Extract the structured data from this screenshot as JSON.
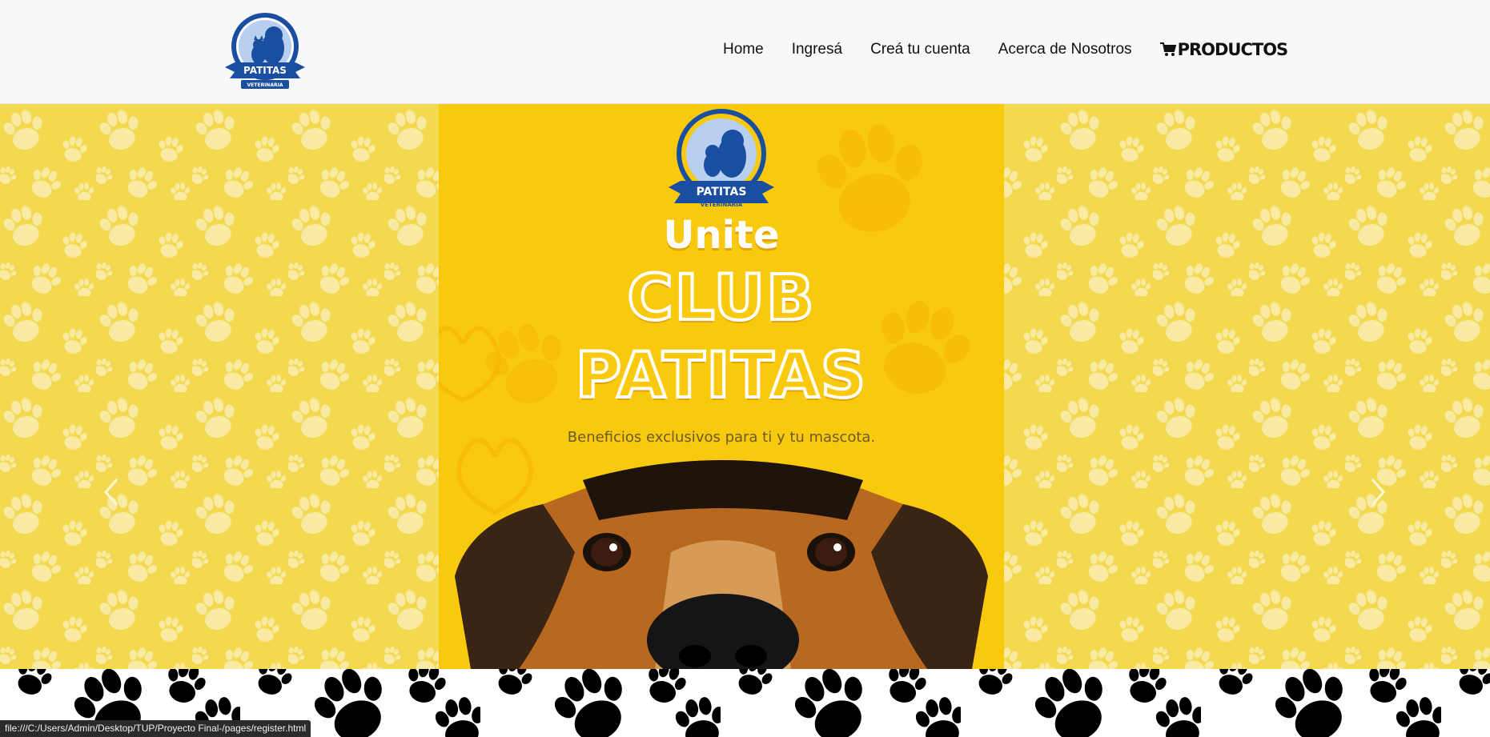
{
  "brand": {
    "logo_text": "PATITAS",
    "logo_subtext": "VETERINARIA",
    "colors": {
      "blue": "#1a4ea1",
      "light_blue": "#b9cff0",
      "gold": "#f9c90e"
    }
  },
  "nav": {
    "items": [
      {
        "label": "Home"
      },
      {
        "label": "Ingresá"
      },
      {
        "label": "Creá tu cuenta"
      },
      {
        "label": "Acerca de Nosotros"
      }
    ],
    "products": {
      "label": "PRODUCTOS",
      "icon": "cart-icon"
    }
  },
  "hero": {
    "background_color": "#f3d94f",
    "promo": {
      "title_line1": "Unite",
      "title_line2": "CLUB",
      "title_line3": "PATITAS",
      "subtitle": "Beneficios exclusivos para ti y tu mascota."
    },
    "controls": {
      "prev_icon": "chevron-left-icon",
      "next_icon": "chevron-right-icon"
    }
  },
  "status_bar": {
    "url": "file:///C:/Users/Admin/Desktop/TUP/Proyecto Final-/pages/register.html"
  }
}
